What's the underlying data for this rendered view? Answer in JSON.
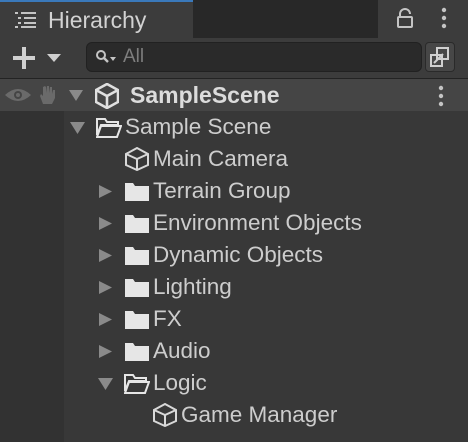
{
  "window": {
    "tab_title": "Hierarchy",
    "tab_icon": "hierarchy-list-icon",
    "lock_icon": "lock-icon",
    "menu_icon": "kebab-menu-icon",
    "accent_color": "#3a79bb"
  },
  "toolbar": {
    "add_icon": "plus-icon",
    "add_dropdown_icon": "caret-down-icon",
    "search": {
      "placeholder": "All",
      "value": "",
      "icon": "search-icon"
    },
    "mode_icon": "hierarchy-mode-icon"
  },
  "scene": {
    "name": "SampleScene",
    "icon": "unity-scene-icon",
    "expanded": true,
    "visibility_icon": "eye-icon",
    "pickability_icon": "hand-icon",
    "menu_icon": "kebab-menu-icon"
  },
  "tree": [
    {
      "label": "Sample Scene",
      "type": "folder",
      "expanded": true,
      "has_children": true,
      "depth": 1
    },
    {
      "label": "Main Camera",
      "type": "gameobject",
      "expanded": false,
      "has_children": false,
      "depth": 2
    },
    {
      "label": "Terrain Group",
      "type": "folder",
      "expanded": false,
      "has_children": true,
      "depth": 2
    },
    {
      "label": "Environment Objects",
      "type": "folder",
      "expanded": false,
      "has_children": true,
      "depth": 2
    },
    {
      "label": "Dynamic Objects",
      "type": "folder",
      "expanded": false,
      "has_children": true,
      "depth": 2
    },
    {
      "label": "Lighting",
      "type": "folder",
      "expanded": false,
      "has_children": true,
      "depth": 2
    },
    {
      "label": "FX",
      "type": "folder",
      "expanded": false,
      "has_children": true,
      "depth": 2
    },
    {
      "label": "Audio",
      "type": "folder",
      "expanded": false,
      "has_children": true,
      "depth": 2
    },
    {
      "label": "Logic",
      "type": "folder",
      "expanded": true,
      "has_children": true,
      "depth": 2
    },
    {
      "label": "Game Manager",
      "type": "gameobject",
      "expanded": false,
      "has_children": false,
      "depth": 3
    }
  ]
}
